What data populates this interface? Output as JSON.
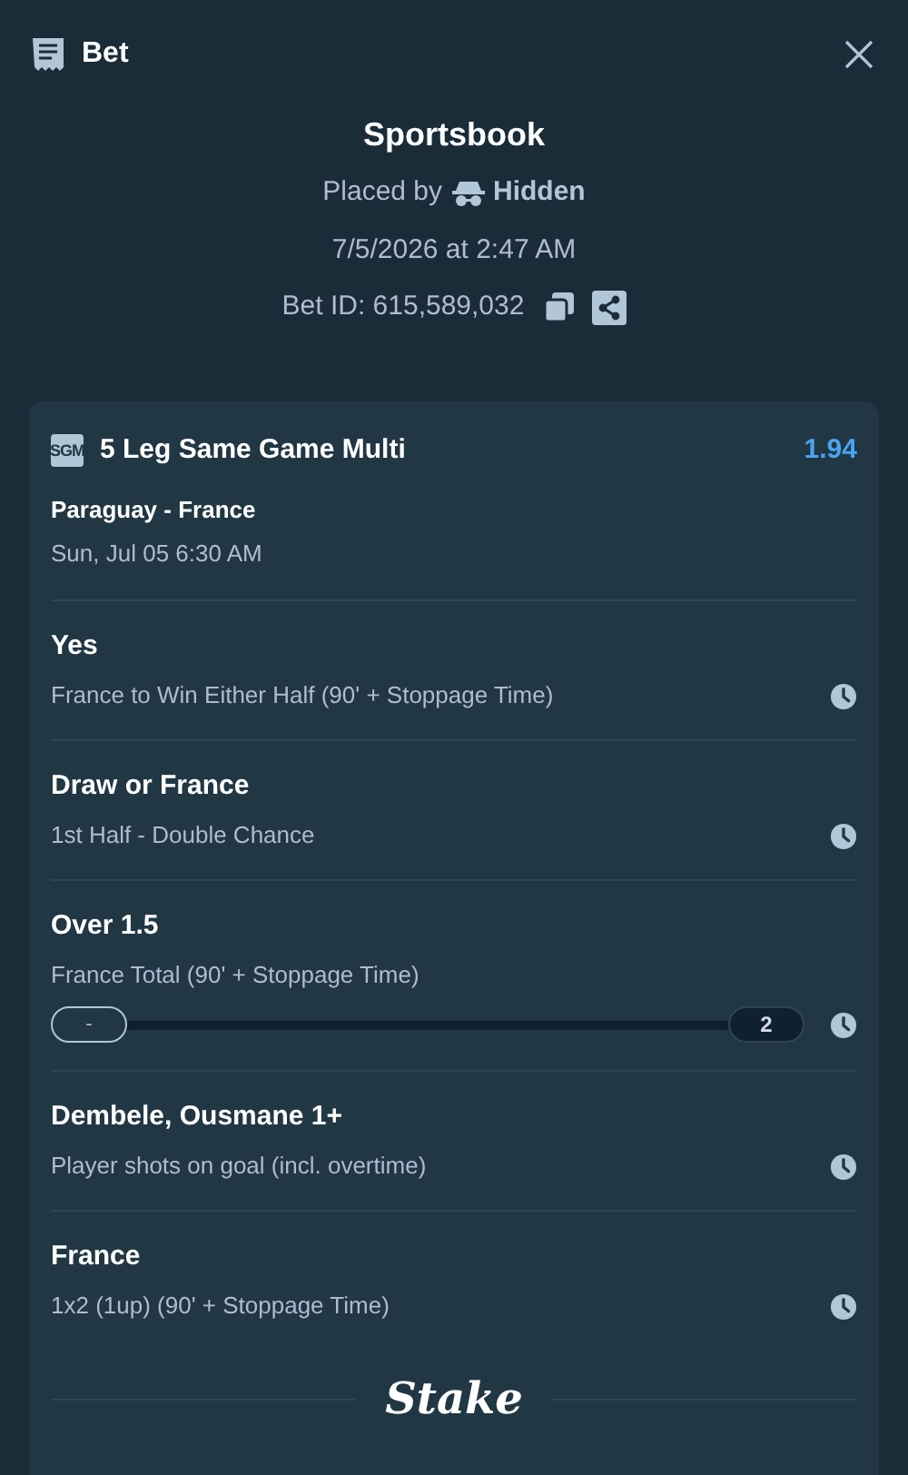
{
  "header": {
    "title": "Bet"
  },
  "summary": {
    "title": "Sportsbook",
    "placed_by_label": "Placed by",
    "user": "Hidden",
    "datetime": "7/5/2026 at 2:47 AM",
    "bet_id": "Bet ID: 615,589,032"
  },
  "bet": {
    "badge": "SGM",
    "title": "5 Leg Same Game Multi",
    "odds": "1.94",
    "match": "Paraguay - France",
    "match_time": "Sun, Jul 05 6:30 AM",
    "legs": [
      {
        "kind": "plain",
        "selection": "Yes",
        "market": "France to Win Either Half (90' + Stoppage Time)"
      },
      {
        "kind": "plain",
        "selection": "Draw or France",
        "market": "1st Half - Double Chance"
      },
      {
        "kind": "progress",
        "selection": "Over 1.5",
        "market": "France Total (90' + Stoppage Time)",
        "current": "-",
        "target": "2"
      },
      {
        "kind": "plain",
        "selection": "Dembele, Ousmane 1+",
        "market": "Player shots on goal (incl. overtime)"
      },
      {
        "kind": "plain",
        "selection": "France",
        "market": "1x2 (1up) (90' + Stoppage Time)"
      }
    ]
  },
  "footer": {
    "logo": "Stake"
  }
}
